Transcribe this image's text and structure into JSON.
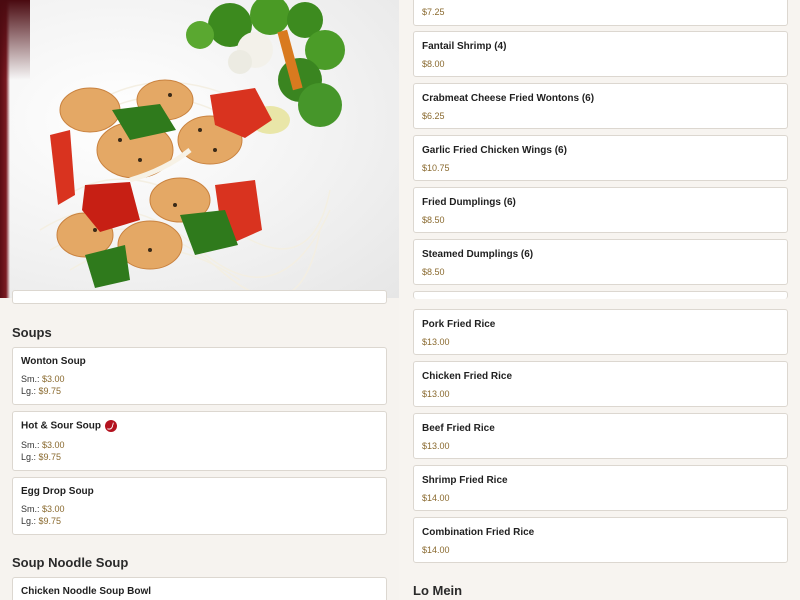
{
  "left": {
    "soups_title": "Soups",
    "soups": [
      {
        "name": "Wonton Soup",
        "sm_label": "Sm.:",
        "sm_price": "$3.00",
        "lg_label": "Lg.:",
        "lg_price": "$9.75"
      },
      {
        "name": "Hot & Sour Soup",
        "hot": true,
        "sm_label": "Sm.:",
        "sm_price": "$3.00",
        "lg_label": "Lg.:",
        "lg_price": "$9.75"
      },
      {
        "name": "Egg Drop Soup",
        "sm_label": "Sm.:",
        "sm_price": "$3.00",
        "lg_label": "Lg.:",
        "lg_price": "$9.75"
      }
    ],
    "noodle_title": "Soup Noodle Soup",
    "noodle_items": [
      {
        "name": "Chicken Noodle Soup Bowl"
      }
    ],
    "photo_icon": "shrimp-stir-fry-photo"
  },
  "right": {
    "top_partial_price": "$7.25",
    "appetizers": [
      {
        "name": "Fantail Shrimp (4)",
        "price": "$8.00"
      },
      {
        "name": "Crabmeat Cheese Fried Wontons (6)",
        "price": "$6.25"
      },
      {
        "name": "Garlic Fried Chicken Wings (6)",
        "price": "$10.75"
      },
      {
        "name": "Fried Dumplings (6)",
        "price": "$8.50"
      },
      {
        "name": "Steamed Dumplings (6)",
        "price": "$8.50"
      }
    ],
    "fried_rice": [
      {
        "name": "Pork Fried Rice",
        "price": "$13.00"
      },
      {
        "name": "Chicken Fried Rice",
        "price": "$13.00"
      },
      {
        "name": "Beef Fried Rice",
        "price": "$13.00"
      },
      {
        "name": "Shrimp Fried Rice",
        "price": "$14.00"
      },
      {
        "name": "Combination Fried Rice",
        "price": "$14.00"
      }
    ],
    "lo_mein_title": "Lo Mein"
  },
  "colors": {
    "price": "#8a6a2f",
    "hot_icon": "#b3121f",
    "background": "#f6f3ef"
  }
}
